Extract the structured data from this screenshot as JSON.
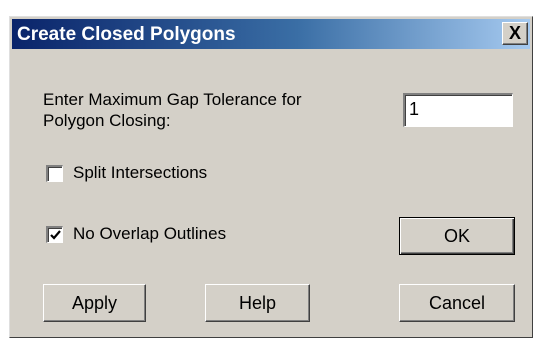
{
  "window": {
    "title": "Create Closed Polygons",
    "close_glyph": "X"
  },
  "form": {
    "gap_label_line1": "Enter Maximum Gap Tolerance for",
    "gap_label_line2": "Polygon Closing:",
    "gap_value": "1",
    "split_intersections": {
      "label": "Split Intersections",
      "checked": false
    },
    "no_overlap_outlines": {
      "label": "No Overlap Outlines",
      "checked": true
    }
  },
  "buttons": {
    "ok": "OK",
    "apply": "Apply",
    "help": "Help",
    "cancel": "Cancel"
  },
  "colors": {
    "dialog_bg": "#d4d0c8",
    "title_start": "#0a246a",
    "title_end": "#a6caf0"
  }
}
